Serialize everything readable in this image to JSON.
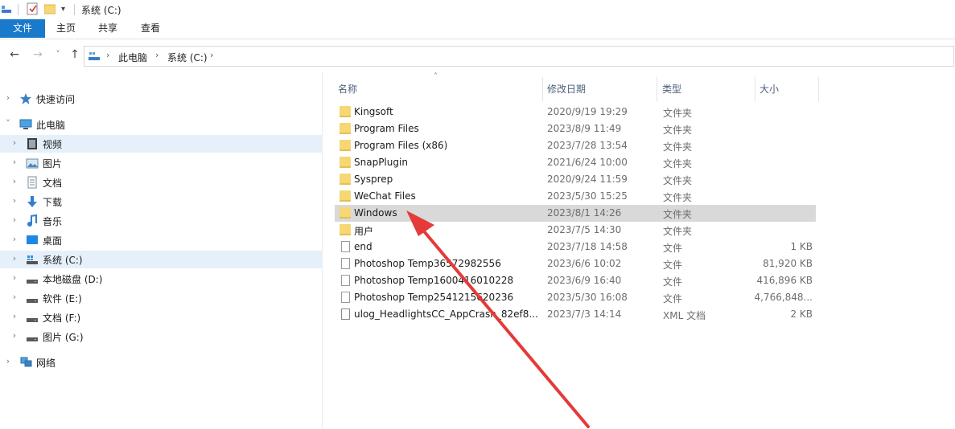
{
  "window": {
    "title": "系统 (C:)"
  },
  "ribbon": {
    "tabs": [
      "文件",
      "主页",
      "共享",
      "查看"
    ]
  },
  "address": {
    "crumbs": [
      "此电脑",
      "系统 (C:)"
    ],
    "nav": {
      "back": "←",
      "forward": "→",
      "recent": "˅",
      "up": "↑"
    }
  },
  "sidebar": {
    "items": [
      {
        "label": "快速访问",
        "icon": "star-icon",
        "expand": "›",
        "indent": 0
      },
      {
        "label": "此电脑",
        "icon": "computer-icon",
        "expand": "˅",
        "indent": 0
      },
      {
        "label": "视频",
        "icon": "video-folder-icon",
        "expand": "›",
        "indent": 1,
        "selected": true
      },
      {
        "label": "图片",
        "icon": "pictures-folder-icon",
        "expand": "›",
        "indent": 1
      },
      {
        "label": "文档",
        "icon": "documents-folder-icon",
        "expand": "›",
        "indent": 1
      },
      {
        "label": "下载",
        "icon": "download-icon",
        "expand": "›",
        "indent": 1
      },
      {
        "label": "音乐",
        "icon": "music-icon",
        "expand": "›",
        "indent": 1
      },
      {
        "label": "桌面",
        "icon": "desktop-icon",
        "expand": "›",
        "indent": 1
      },
      {
        "label": "系统 (C:)",
        "icon": "system-drive-icon",
        "expand": "›",
        "indent": 1,
        "selected": true
      },
      {
        "label": "本地磁盘 (D:)",
        "icon": "drive-icon",
        "expand": "›",
        "indent": 1
      },
      {
        "label": "软件 (E:)",
        "icon": "drive-icon",
        "expand": "›",
        "indent": 1
      },
      {
        "label": "文档 (F:)",
        "icon": "drive-icon",
        "expand": "›",
        "indent": 1
      },
      {
        "label": "图片 (G:)",
        "icon": "drive-icon",
        "expand": "›",
        "indent": 1
      },
      {
        "label": "网络",
        "icon": "network-icon",
        "expand": "›",
        "indent": 0
      }
    ]
  },
  "filelist": {
    "headers": {
      "name": "名称",
      "date": "修改日期",
      "type": "类型",
      "size": "大小",
      "sort": "˄"
    },
    "rows": [
      {
        "name": "Kingsoft",
        "date": "2020/9/19 19:29",
        "type": "文件夹",
        "size": "",
        "kind": "folder"
      },
      {
        "name": "Program Files",
        "date": "2023/8/9 11:49",
        "type": "文件夹",
        "size": "",
        "kind": "folder"
      },
      {
        "name": "Program Files (x86)",
        "date": "2023/7/28 13:54",
        "type": "文件夹",
        "size": "",
        "kind": "folder"
      },
      {
        "name": "SnapPlugin",
        "date": "2021/6/24 10:00",
        "type": "文件夹",
        "size": "",
        "kind": "folder"
      },
      {
        "name": "Sysprep",
        "date": "2020/9/24 11:59",
        "type": "文件夹",
        "size": "",
        "kind": "folder"
      },
      {
        "name": "WeChat Files",
        "date": "2023/5/30 15:25",
        "type": "文件夹",
        "size": "",
        "kind": "folder"
      },
      {
        "name": "Windows",
        "date": "2023/8/1 14:26",
        "type": "文件夹",
        "size": "",
        "kind": "folder",
        "highlight": true
      },
      {
        "name": "用户",
        "date": "2023/7/5 14:30",
        "type": "文件夹",
        "size": "",
        "kind": "folder"
      },
      {
        "name": "end",
        "date": "2023/7/18 14:58",
        "type": "文件",
        "size": "1 KB",
        "kind": "file"
      },
      {
        "name": "Photoshop Temp36​572982556",
        "date": "2023/6/6 10:02",
        "type": "文件",
        "size": "81,920 KB",
        "kind": "file"
      },
      {
        "name": "Photoshop Temp16004​16010228",
        "date": "2023/6/9 16:40",
        "type": "文件",
        "size": "416,896 KB",
        "kind": "file"
      },
      {
        "name": "Photoshop Temp254121​5​620236",
        "date": "2023/5/30 16:08",
        "type": "文件",
        "size": "4,766,848...",
        "kind": "file"
      },
      {
        "name": "ulog_HeadlightsCC_AppCrash_82ef8...",
        "date": "2023/7/3 14:14",
        "type": "XML 文档",
        "size": "2 KB",
        "kind": "xml"
      }
    ]
  },
  "annotation": {
    "arrow_color": "#e53a3a"
  }
}
